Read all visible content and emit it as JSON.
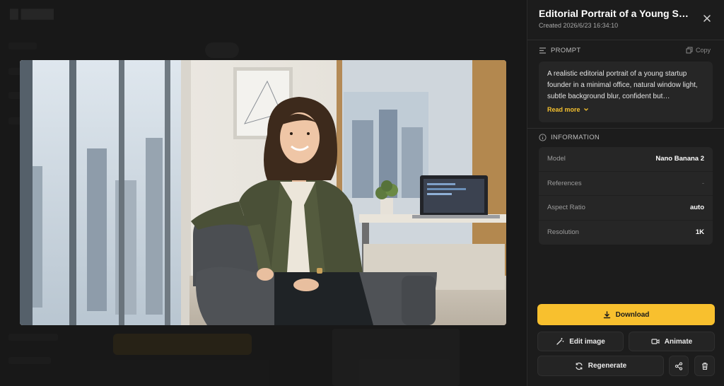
{
  "detail": {
    "title": "Editorial Portrait of a Young Sta⋯",
    "created": "Created 2026/6/23 16:34:10",
    "prompt": {
      "heading": "PROMPT",
      "copy_label": "Copy",
      "text": "A realistic editorial portrait of a young startup founder in a minimal office, natural window light, subtle background blur, confident but…",
      "read_more": "Read more"
    },
    "information": {
      "heading": "INFORMATION",
      "rows": [
        {
          "key": "Model",
          "value": "Nano Banana 2"
        },
        {
          "key": "References",
          "value": "-"
        },
        {
          "key": "Aspect Ratio",
          "value": "auto"
        },
        {
          "key": "Resolution",
          "value": "1K"
        }
      ]
    },
    "actions": {
      "download": "Download",
      "edit_image": "Edit image",
      "animate": "Animate",
      "regenerate": "Regenerate"
    }
  },
  "colors": {
    "accent": "#f8c02e",
    "panel_bg": "#1c1c1c",
    "card_bg": "#262626"
  },
  "icons": [
    "close-icon",
    "prompt-icon",
    "copy-icon",
    "chevron-down-icon",
    "info-icon",
    "download-icon",
    "magic-wand-icon",
    "video-icon",
    "refresh-icon",
    "share-icon",
    "trash-icon"
  ]
}
